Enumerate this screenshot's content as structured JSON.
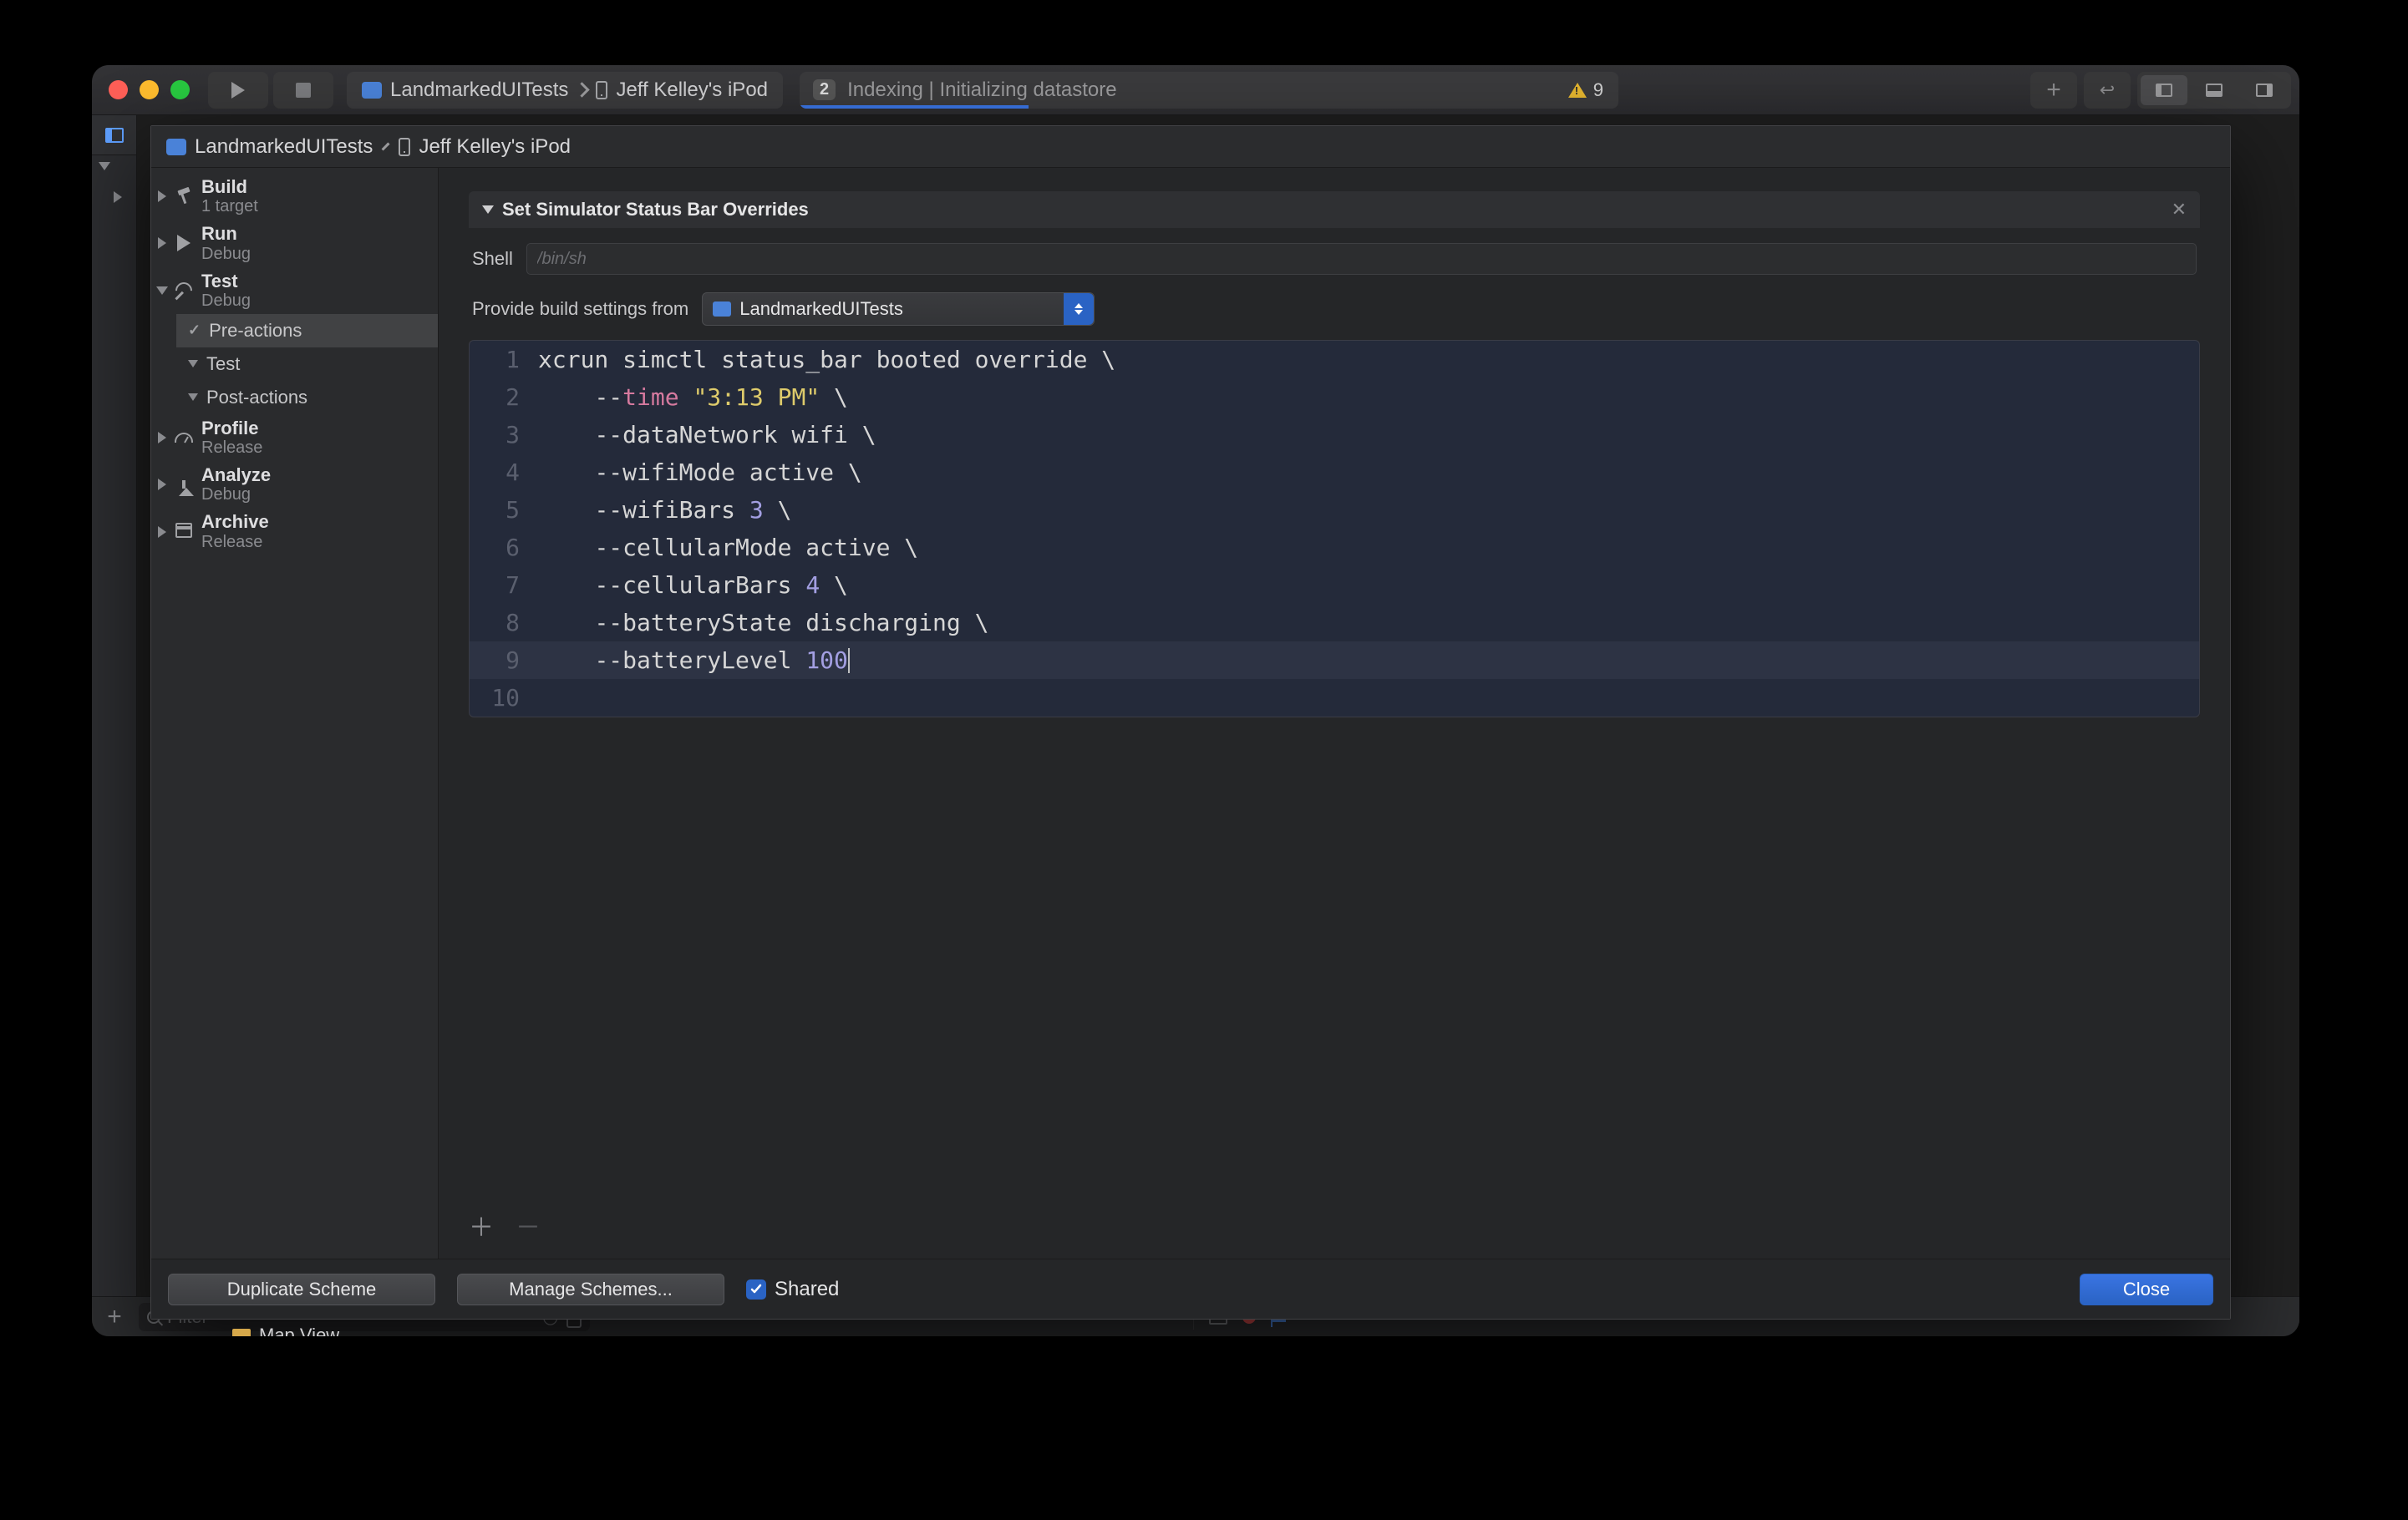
{
  "toolbar": {
    "scheme_project": "LandmarkedUITests",
    "scheme_device": "Jeff Kelley's iPod",
    "status_badge": "2",
    "status_text": "Indexing | Initializing datastore",
    "warn_count": "9"
  },
  "breadcrumb": {
    "project": "LandmarkedUITests",
    "device": "Jeff Kelley's iPod"
  },
  "scheme_sidebar": {
    "build": {
      "title": "Build",
      "sub": "1 target"
    },
    "run": {
      "title": "Run",
      "sub": "Debug"
    },
    "test": {
      "title": "Test",
      "sub": "Debug"
    },
    "test_sub": {
      "pre": "Pre-actions",
      "test": "Test",
      "post": "Post-actions"
    },
    "profile": {
      "title": "Profile",
      "sub": "Release"
    },
    "analyze": {
      "title": "Analyze",
      "sub": "Debug"
    },
    "archive": {
      "title": "Archive",
      "sub": "Release"
    }
  },
  "section": {
    "title": "Set Simulator Status Bar Overrides",
    "shell_label": "Shell",
    "shell_placeholder": "/bin/sh",
    "shell_value": "",
    "build_settings_label": "Provide build settings from",
    "build_settings_value": "LandmarkedUITests"
  },
  "code": {
    "lines": [
      {
        "n": "1",
        "pre": "",
        "tokens": [
          [
            "w",
            "xcrun simctl status_bar booted override \\"
          ]
        ]
      },
      {
        "n": "2",
        "pre": "    ",
        "tokens": [
          [
            "w",
            "--"
          ],
          [
            "p",
            "time"
          ],
          [
            "w",
            " "
          ],
          [
            "y",
            "\"3:13 PM\""
          ],
          [
            "w",
            " \\"
          ]
        ]
      },
      {
        "n": "3",
        "pre": "    ",
        "tokens": [
          [
            "w",
            "--dataNetwork wifi \\"
          ]
        ]
      },
      {
        "n": "4",
        "pre": "    ",
        "tokens": [
          [
            "w",
            "--wifiMode active \\"
          ]
        ]
      },
      {
        "n": "5",
        "pre": "    ",
        "tokens": [
          [
            "w",
            "--wifiBars "
          ],
          [
            "u",
            "3"
          ],
          [
            "w",
            " \\"
          ]
        ]
      },
      {
        "n": "6",
        "pre": "    ",
        "tokens": [
          [
            "w",
            "--cellularMode active \\"
          ]
        ]
      },
      {
        "n": "7",
        "pre": "    ",
        "tokens": [
          [
            "w",
            "--cellularBars "
          ],
          [
            "u",
            "4"
          ],
          [
            "w",
            " \\"
          ]
        ]
      },
      {
        "n": "8",
        "pre": "    ",
        "tokens": [
          [
            "w",
            "--batteryState discharging \\"
          ]
        ]
      },
      {
        "n": "9",
        "pre": "    ",
        "tokens": [
          [
            "w",
            "--batteryLevel "
          ],
          [
            "u",
            "100"
          ]
        ],
        "caret": true,
        "hl": true
      },
      {
        "n": "10",
        "pre": "",
        "tokens": []
      }
    ]
  },
  "footer": {
    "duplicate": "Duplicate Scheme",
    "manage": "Manage Schemes...",
    "shared": "Shared",
    "close": "Close"
  },
  "bottom": {
    "filter_placeholder": "Filter",
    "map_peek": "Map View"
  }
}
